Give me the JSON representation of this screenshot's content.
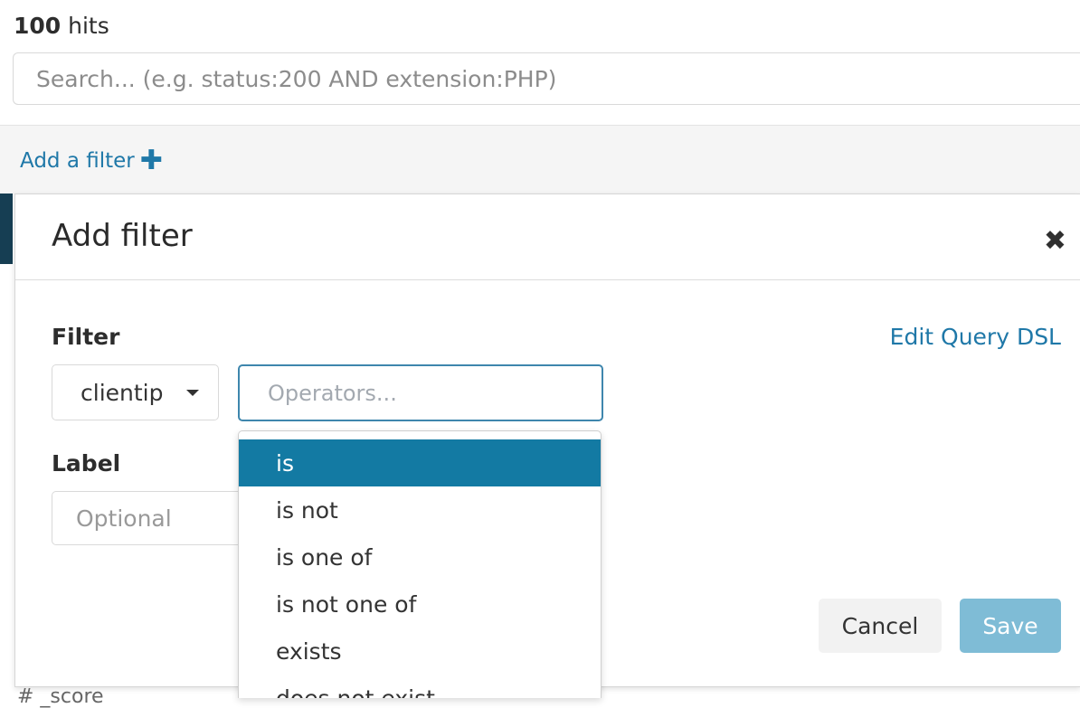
{
  "hits": {
    "count": "100",
    "label": "hits"
  },
  "search": {
    "placeholder": "Search... (e.g. status:200 AND extension:PHP)"
  },
  "filterbar": {
    "add_filter_label": "Add a filter",
    "plus_glyph": "✚"
  },
  "panel": {
    "title": "Add filter",
    "close_glyph": "✖",
    "filter_heading": "Filter",
    "edit_dsl_label": "Edit Query DSL",
    "field_value": "clientip",
    "operators_placeholder": "Operators...",
    "label_heading": "Label",
    "label_placeholder": "Optional",
    "cancel_label": "Cancel",
    "save_label": "Save"
  },
  "operators_list": [
    "is",
    "is not",
    "is one of",
    "is not one of",
    "exists",
    "does not exist"
  ],
  "bottom": {
    "text": "#    _score"
  },
  "colors": {
    "accent": "#1f78a8",
    "selected": "#137aa3",
    "save_disabled": "#7fbcd6"
  }
}
